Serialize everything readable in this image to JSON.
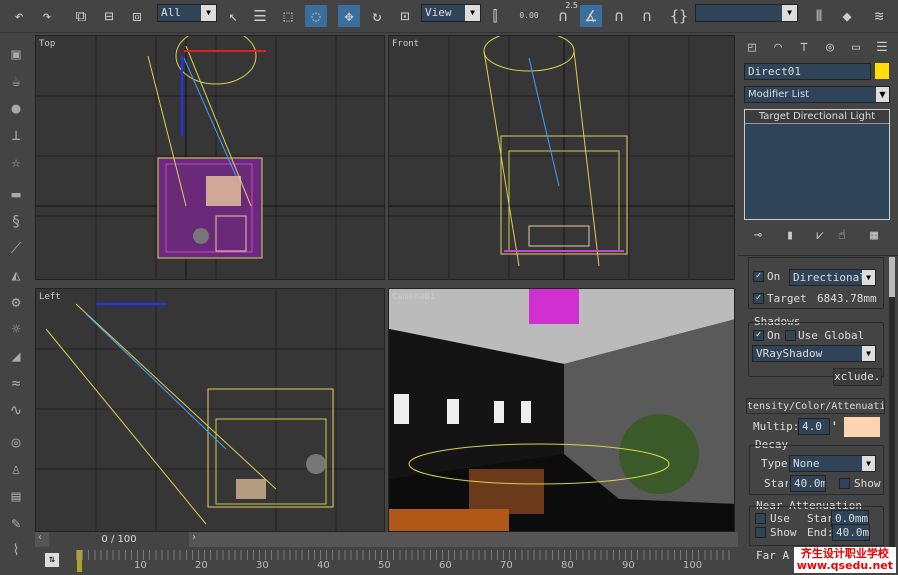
{
  "toolbar": {
    "selection_filter": "All",
    "ref_coord": "View",
    "snap_spinner": "0.00",
    "angle_snap": "2.5",
    "percent_snap": "%",
    "named_selection": ""
  },
  "viewports": {
    "top": "Top",
    "front": "Front",
    "left": "Left",
    "camera": "Camera01"
  },
  "panel": {
    "object_name": "Direct01",
    "object_color": "#ffdd00",
    "modifier_list": "Modifier List",
    "stack_item": "Target Directional Light",
    "light_type": {
      "on_label": "On",
      "on": true,
      "type": "Directional",
      "targeted_label": "Targete",
      "targeted": true,
      "target_distance": "6843.78mm"
    },
    "shadows": {
      "title": "Shadows",
      "on_label": "On",
      "on": true,
      "use_global_label": "Use Global",
      "use_global": false,
      "type": "VRayShadow",
      "exclude": "xclude.."
    },
    "intensity": {
      "rollout": "tensity/Color/Attenuati",
      "multiplier_label": "Multip:",
      "multiplier": "4.0",
      "color": "#ffd4b0"
    },
    "decay": {
      "title": "Decay",
      "type_label": "Type",
      "type": "None",
      "start_label": "Star",
      "start": "40.0m",
      "show_label": "Show",
      "show": false
    },
    "near": {
      "title": "Near Attenuation",
      "use_label": "Use",
      "use": false,
      "show_label": "Show",
      "show": false,
      "start_label": "Star",
      "start": "0.0mm",
      "end_label": "End:",
      "end": "40.0mm"
    },
    "far": {
      "title": "Far A"
    }
  },
  "timeline": {
    "frame": "0 / 100",
    "current": 0,
    "ticks": [
      "10",
      "20",
      "30",
      "40",
      "50",
      "60",
      "70",
      "80",
      "90",
      "100"
    ]
  },
  "watermark": {
    "line1": "齐生设计职业学校",
    "line2": "www.qsedu.net"
  }
}
